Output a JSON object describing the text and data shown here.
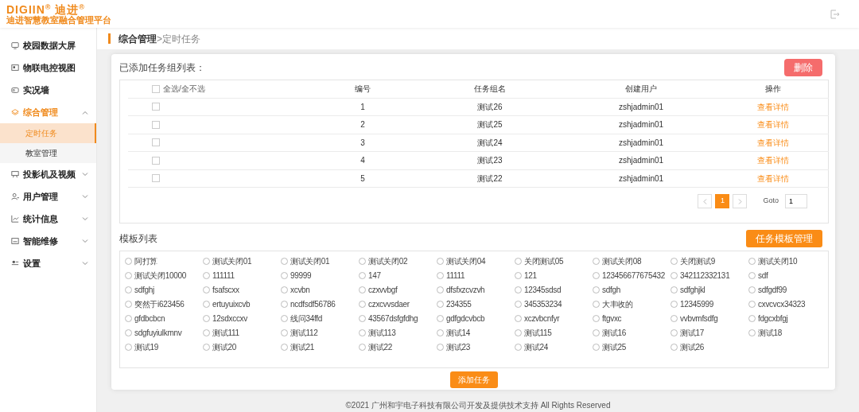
{
  "header": {
    "brand": "DIGIIN$^{®}$ 迪进$^{®}$",
    "platform": "迪进智慧教室融合管理平台"
  },
  "sidebar": {
    "items": [
      {
        "label": "校园数据大屏",
        "selected": false
      },
      {
        "label": "物联电控视图",
        "selected": false
      },
      {
        "label": "实况墙",
        "selected": false
      },
      {
        "label": "综合管理",
        "selected": true,
        "expanded": true,
        "children": [
          {
            "label": "定时任务",
            "selected": true
          },
          {
            "label": "教室管理",
            "selected": false
          }
        ]
      },
      {
        "label": "投影机及视频",
        "selected": false,
        "expanded": false
      },
      {
        "label": "用户管理",
        "selected": false,
        "expanded": false
      },
      {
        "label": "统计信息",
        "selected": false,
        "expanded": false
      },
      {
        "label": "智能维修",
        "selected": false,
        "expanded": false
      },
      {
        "label": "设置",
        "selected": false,
        "expanded": false
      }
    ]
  },
  "breadcrumb": {
    "parent": "综合管理",
    "separator": ">",
    "current": "定时任务"
  },
  "task_groups": {
    "title": "已添加任务组列表：",
    "delete_button": "删除",
    "table": {
      "select_all": {
        "label": "全选/全不选",
        "checked": false
      },
      "columns": [
        "编号",
        "任务组名",
        "创建用户",
        "操作"
      ],
      "rows": [
        {
          "checked": false,
          "cells": [
            "1",
            "测试26",
            "zshjadmin01"
          ],
          "action": "查看详情"
        },
        {
          "checked": false,
          "cells": [
            "2",
            "测试25",
            "zshjadmin01"
          ],
          "action": "查看详情"
        },
        {
          "checked": false,
          "cells": [
            "3",
            "测试24",
            "zshjadmin01"
          ],
          "action": "查看详情"
        },
        {
          "checked": false,
          "cells": [
            "4",
            "测试23",
            "zshjadmin01"
          ],
          "action": "查看详情"
        },
        {
          "checked": false,
          "cells": [
            "5",
            "测试22",
            "zshjadmin01"
          ],
          "action": "查看详情"
        }
      ]
    },
    "pagination": {
      "pages": [
        {
          "label": "1",
          "selected": true
        }
      ],
      "goto_label": "Goto",
      "goto_value": "1"
    }
  },
  "templates": {
    "title": "模板列表",
    "manage_button": "任务模板管理",
    "items": [
      {
        "label": "阿打算",
        "selected": false
      },
      {
        "label": "测试关闭01",
        "selected": false
      },
      {
        "label": "测试关闭01",
        "selected": false
      },
      {
        "label": "测试关闭02",
        "selected": false
      },
      {
        "label": "测试关闭04",
        "selected": false
      },
      {
        "label": "关闭测试05",
        "selected": false
      },
      {
        "label": "测试关闭08",
        "selected": false
      },
      {
        "label": "关闭测试9",
        "selected": false
      },
      {
        "label": "测试关闭10",
        "selected": false
      },
      {
        "label": "测试关闭10000",
        "selected": false
      },
      {
        "label": "111111",
        "selected": false
      },
      {
        "label": "99999",
        "selected": false
      },
      {
        "label": "147",
        "selected": false
      },
      {
        "label": "11111",
        "selected": false
      },
      {
        "label": "121",
        "selected": false
      },
      {
        "label": "123456677675432",
        "selected": false
      },
      {
        "label": "342112332131",
        "selected": false
      },
      {
        "label": "sdf",
        "selected": false
      },
      {
        "label": "sdfghj",
        "selected": false
      },
      {
        "label": "fsafscxx",
        "selected": false
      },
      {
        "label": "xcvbn",
        "selected": false
      },
      {
        "label": "czxvvbgf",
        "selected": false
      },
      {
        "label": "dfsfxzcvzvh",
        "selected": false
      },
      {
        "label": "12345sdsd",
        "selected": false
      },
      {
        "label": "sdfgh",
        "selected": false
      },
      {
        "label": "sdfghjkl",
        "selected": false
      },
      {
        "label": "sdfgdf99",
        "selected": false
      },
      {
        "label": "突然于i623456",
        "selected": false
      },
      {
        "label": "ertuyuixcvb",
        "selected": false
      },
      {
        "label": "ncdfsdf56786",
        "selected": false
      },
      {
        "label": "czxcvvsdaer",
        "selected": false
      },
      {
        "label": "234355",
        "selected": false
      },
      {
        "label": "345353234",
        "selected": false
      },
      {
        "label": "大丰收的",
        "selected": false
      },
      {
        "label": "12345999",
        "selected": false
      },
      {
        "label": "cxvcvcx34323",
        "selected": false
      },
      {
        "label": "gfdbcbcn",
        "selected": false
      },
      {
        "label": "12sdxccxv",
        "selected": false
      },
      {
        "label": "线问34ffd",
        "selected": false
      },
      {
        "label": "43567dsfgfdhg",
        "selected": false
      },
      {
        "label": "gdfgdcvbcb",
        "selected": false
      },
      {
        "label": "xczvbcnfyr",
        "selected": false
      },
      {
        "label": "ftgvxc",
        "selected": false
      },
      {
        "label": "vvbvmfsdfg",
        "selected": false
      },
      {
        "label": "fdgcxbfgj",
        "selected": false
      },
      {
        "label": "sdgfuyiulkmnv",
        "selected": false
      },
      {
        "label": "测试111",
        "selected": false
      },
      {
        "label": "测试112",
        "selected": false
      },
      {
        "label": "测试113",
        "selected": false
      },
      {
        "label": "测试14",
        "selected": false
      },
      {
        "label": "测试115",
        "selected": false
      },
      {
        "label": "测试16",
        "selected": false
      },
      {
        "label": "测试17",
        "selected": false
      },
      {
        "label": "测试18",
        "selected": false
      },
      {
        "label": "测试19",
        "selected": false
      },
      {
        "label": "测试20",
        "selected": false
      },
      {
        "label": "测试21",
        "selected": false
      },
      {
        "label": "测试22",
        "selected": false
      },
      {
        "label": "测试23",
        "selected": false
      },
      {
        "label": "测试24",
        "selected": false
      },
      {
        "label": "测试25",
        "selected": false
      },
      {
        "label": "测试26",
        "selected": false
      }
    ],
    "add_button": "添加任务"
  },
  "footer": "©2021 广州和宇电子科技有限公司开发及提供技术支持 All Rights Reserved"
}
